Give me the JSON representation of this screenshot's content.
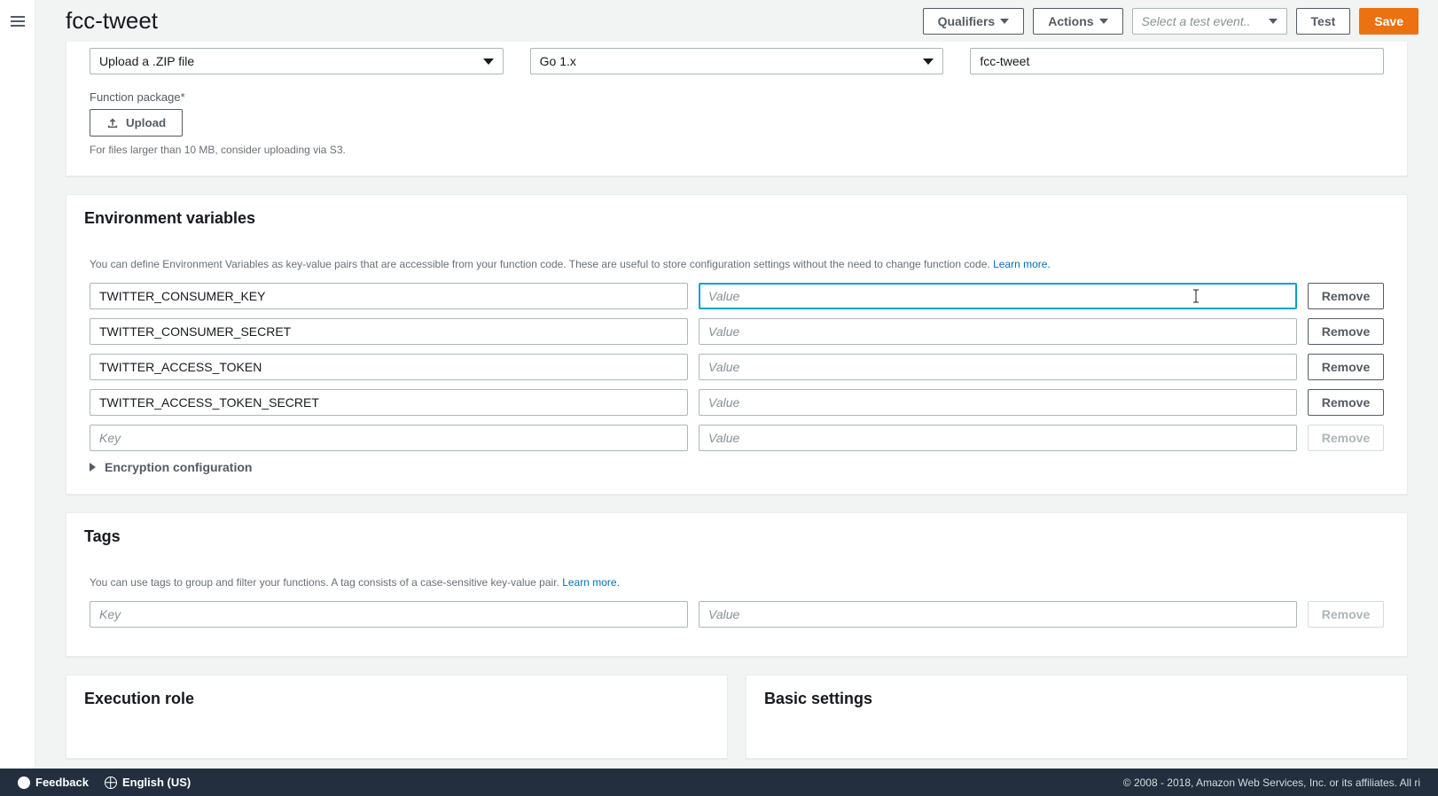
{
  "header": {
    "title": "fcc-tweet",
    "qualifiers_label": "Qualifiers",
    "actions_label": "Actions",
    "test_select_placeholder": "Select a test event..",
    "test_label": "Test",
    "save_label": "Save"
  },
  "code_entry": {
    "entry_type_value": "Upload a .ZIP file",
    "runtime_value": "Go 1.x",
    "handler_value": "fcc-tweet",
    "package_label": "Function package*",
    "upload_label": "Upload",
    "upload_helper": "For files larger than 10 MB, consider uploading via S3."
  },
  "env": {
    "title": "Environment variables",
    "desc": "You can define Environment Variables as key-value pairs that are accessible from your function code. These are useful to store configuration settings without the need to change function code. ",
    "learn_more": "Learn more.",
    "key_placeholder": "Key",
    "value_placeholder": "Value",
    "remove_label": "Remove",
    "encryption_label": "Encryption configuration",
    "rows": [
      {
        "key": "TWITTER_CONSUMER_KEY",
        "value": "",
        "focused": true
      },
      {
        "key": "TWITTER_CONSUMER_SECRET",
        "value": ""
      },
      {
        "key": "TWITTER_ACCESS_TOKEN",
        "value": ""
      },
      {
        "key": "TWITTER_ACCESS_TOKEN_SECRET",
        "value": ""
      }
    ]
  },
  "tags": {
    "title": "Tags",
    "desc": "You can use tags to group and filter your functions. A tag consists of a case-sensitive key-value pair. ",
    "learn_more": "Learn more.",
    "key_placeholder": "Key",
    "value_placeholder": "Value",
    "remove_label": "Remove"
  },
  "exec_role": {
    "title": "Execution role"
  },
  "basic": {
    "title": "Basic settings"
  },
  "footer": {
    "feedback": "Feedback",
    "language": "English (US)",
    "copyright": "© 2008 - 2018, Amazon Web Services, Inc. or its affiliates. All ri"
  }
}
